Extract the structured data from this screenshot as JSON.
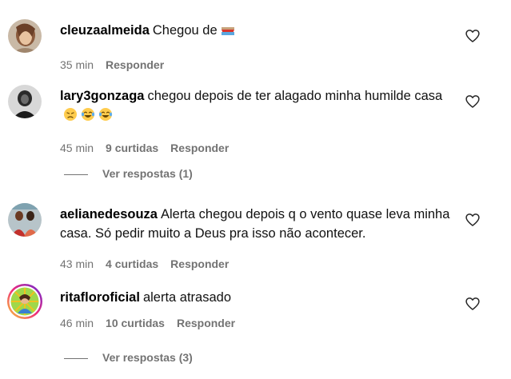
{
  "comments": [
    {
      "username": "cleuzaalmeida",
      "text": "Chegou de",
      "emojis": [
        "boat-emoji"
      ],
      "time": "35 min",
      "likes": "",
      "reply_label": "Responder"
    },
    {
      "username": "lary3gonzaga",
      "text": "chegou depois de ter alagado minha humilde casa",
      "emojis": [
        "disappointed-face-emoji",
        "laughing-tears-emoji",
        "laughing-tears-emoji"
      ],
      "time": "45 min",
      "likes": "9 curtidas",
      "reply_label": "Responder",
      "view_replies": "Ver respostas (1)"
    },
    {
      "username": "aelianedesouza",
      "text": "Alerta chegou depois q o vento quase leva minha casa. Só pedir muito a Deus pra isso não acontecer.",
      "emojis": [],
      "time": "43 min",
      "likes": "4 curtidas",
      "reply_label": "Responder"
    },
    {
      "username": "ritafloroficial",
      "text": "alerta atrasado",
      "emojis": [],
      "time": "46 min",
      "likes": "10 curtidas",
      "reply_label": "Responder",
      "view_replies": "Ver respostas (3)"
    }
  ],
  "icons": {
    "like": "heart-outline-icon"
  },
  "colors": {
    "meta_text": "#737373",
    "story_ring_start": "#f9ce34",
    "story_ring_mid": "#ee2a7b",
    "story_ring_end": "#6228d7"
  }
}
